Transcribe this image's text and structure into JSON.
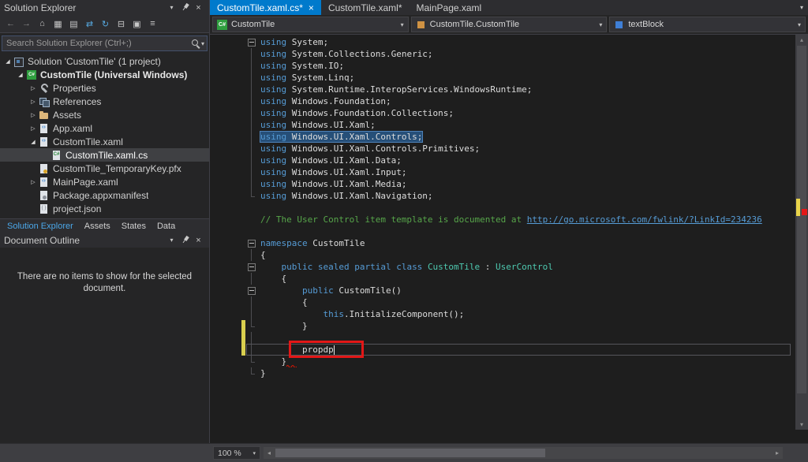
{
  "colors": {
    "accent": "#007acc",
    "editor_background": "#1e1e1e",
    "panel_background": "#252526",
    "keyword": "#569cd6",
    "type_name": "#4ec9b0",
    "comment": "#57a64a",
    "annotation_red": "#e31717",
    "change_bar_yellow": "#d9cf4e",
    "selection": "#264f78"
  },
  "solution_explorer": {
    "title": "Solution Explorer",
    "search_placeholder": "Search Solution Explorer (Ctrl+;)",
    "toolbar_icons": [
      {
        "name": "back",
        "glyph": "←",
        "color": "#8a8a8a"
      },
      {
        "name": "forward",
        "glyph": "→",
        "color": "#8a8a8a"
      },
      {
        "name": "home",
        "glyph": "⌂",
        "color": "#c8c8c8"
      },
      {
        "name": "switch-views",
        "glyph": "▦",
        "color": "#c8c8c8"
      },
      {
        "name": "pending-changes-filter",
        "glyph": "▤",
        "color": "#c8c8c8"
      },
      {
        "name": "sync-with-active-document",
        "glyph": "⇄",
        "color": "#56a9e0"
      },
      {
        "name": "refresh",
        "glyph": "↻",
        "color": "#56a9e0"
      },
      {
        "name": "collapse-all",
        "glyph": "⊟",
        "color": "#c8c8c8"
      },
      {
        "name": "show-all-files",
        "glyph": "▣",
        "color": "#c8c8c8"
      },
      {
        "name": "properties",
        "glyph": "≡",
        "color": "#c8c8c8"
      }
    ],
    "tree": [
      {
        "label": "Solution 'CustomTile' (1 project)",
        "level": 0,
        "icon": "solution",
        "expand": "expanded"
      },
      {
        "label": "CustomTile (Universal Windows)",
        "level": 1,
        "icon": "csharp-project",
        "expand": "expanded",
        "bold": true
      },
      {
        "label": "Properties",
        "level": 2,
        "icon": "properties",
        "expand": "collapsed"
      },
      {
        "label": "References",
        "level": 2,
        "icon": "references",
        "expand": "collapsed"
      },
      {
        "label": "Assets",
        "level": 2,
        "icon": "folder",
        "expand": "collapsed"
      },
      {
        "label": "App.xaml",
        "level": 2,
        "icon": "xaml-file",
        "expand": "collapsed"
      },
      {
        "label": "CustomTile.xaml",
        "level": 2,
        "icon": "xaml-file",
        "expand": "expanded"
      },
      {
        "label": "CustomTile.xaml.cs",
        "level": 3,
        "icon": "cs-file",
        "selected": true
      },
      {
        "label": "CustomTile_TemporaryKey.pfx",
        "level": 2,
        "icon": "certificate"
      },
      {
        "label": "MainPage.xaml",
        "level": 2,
        "icon": "xaml-file",
        "expand": "collapsed"
      },
      {
        "label": "Package.appxmanifest",
        "level": 2,
        "icon": "manifest"
      },
      {
        "label": "project.json",
        "level": 2,
        "icon": "json-file"
      }
    ],
    "bottom_tabs": [
      {
        "label": "Solution Explorer",
        "active": true
      },
      {
        "label": "Assets"
      },
      {
        "label": "States"
      },
      {
        "label": "Data"
      }
    ]
  },
  "document_outline": {
    "title": "Document Outline",
    "empty_message": "There are no items to show for the selected document."
  },
  "editor": {
    "tabs": [
      {
        "label": "CustomTile.xaml.cs*",
        "active": true
      },
      {
        "label": "CustomTile.xaml*"
      },
      {
        "label": "MainPage.xaml"
      }
    ],
    "navbar": {
      "project": "CustomTile",
      "type": "CustomTile.CustomTile",
      "member": "textBlock"
    },
    "zoom": "100 %",
    "code": [
      {
        "fold": "box",
        "t": [
          [
            "kw",
            "using"
          ],
          [
            "pl",
            " System;"
          ]
        ]
      },
      {
        "fold": "line",
        "t": [
          [
            "kw",
            "using"
          ],
          [
            "pl",
            " System.Collections.Generic;"
          ]
        ]
      },
      {
        "fold": "line",
        "t": [
          [
            "kw",
            "using"
          ],
          [
            "pl",
            " System.IO;"
          ]
        ]
      },
      {
        "fold": "line",
        "t": [
          [
            "kw",
            "using"
          ],
          [
            "pl",
            " System.Linq;"
          ]
        ]
      },
      {
        "fold": "line",
        "t": [
          [
            "kw",
            "using"
          ],
          [
            "pl",
            " System.Runtime.InteropServices.WindowsRuntime;"
          ]
        ]
      },
      {
        "fold": "line",
        "t": [
          [
            "kw",
            "using"
          ],
          [
            "pl",
            " Windows.Foundation;"
          ]
        ]
      },
      {
        "fold": "line",
        "t": [
          [
            "kw",
            "using"
          ],
          [
            "pl",
            " Windows.Foundation.Collections;"
          ]
        ]
      },
      {
        "fold": "line",
        "t": [
          [
            "kw",
            "using"
          ],
          [
            "pl",
            " Windows.UI.Xaml;"
          ]
        ]
      },
      {
        "fold": "line",
        "hl": true,
        "t": [
          [
            "kw",
            "using"
          ],
          [
            "pl",
            " Windows.UI.Xaml.Controls;"
          ]
        ]
      },
      {
        "fold": "line",
        "t": [
          [
            "kw",
            "using"
          ],
          [
            "pl",
            " Windows.UI.Xaml.Controls.Primitives;"
          ]
        ]
      },
      {
        "fold": "line",
        "t": [
          [
            "kw",
            "using"
          ],
          [
            "pl",
            " Windows.UI.Xaml.Data;"
          ]
        ]
      },
      {
        "fold": "line",
        "t": [
          [
            "kw",
            "using"
          ],
          [
            "pl",
            " Windows.UI.Xaml.Input;"
          ]
        ]
      },
      {
        "fold": "line",
        "t": [
          [
            "kw",
            "using"
          ],
          [
            "pl",
            " Windows.UI.Xaml.Media;"
          ]
        ]
      },
      {
        "fold": "end",
        "t": [
          [
            "kw",
            "using"
          ],
          [
            "pl",
            " Windows.UI.Xaml.Navigation;"
          ]
        ]
      },
      {
        "t": []
      },
      {
        "t": [
          [
            "cm",
            "// The User Control item template is documented at "
          ],
          [
            "lk",
            "http://go.microsoft.com/fwlink/?LinkId=234236"
          ]
        ]
      },
      {
        "t": []
      },
      {
        "fold": "box",
        "t": [
          [
            "kw",
            "namespace"
          ],
          [
            "pl",
            " CustomTile"
          ]
        ]
      },
      {
        "fold": "line",
        "t": [
          [
            "pl",
            "{"
          ]
        ]
      },
      {
        "fold": "box",
        "t": [
          [
            "pl",
            "    "
          ],
          [
            "kw",
            "public sealed partial class"
          ],
          [
            "pl",
            " "
          ],
          [
            "ty",
            "CustomTile"
          ],
          [
            "pl",
            " : "
          ],
          [
            "ty",
            "UserControl"
          ]
        ]
      },
      {
        "fold": "line",
        "t": [
          [
            "pl",
            "    {"
          ]
        ]
      },
      {
        "fold": "box",
        "t": [
          [
            "pl",
            "        "
          ],
          [
            "kw",
            "public"
          ],
          [
            "pl",
            " CustomTile()"
          ]
        ]
      },
      {
        "fold": "line",
        "t": [
          [
            "pl",
            "        {"
          ]
        ]
      },
      {
        "fold": "line",
        "t": [
          [
            "pl",
            "            "
          ],
          [
            "kw",
            "this"
          ],
          [
            "pl",
            ".InitializeComponent();"
          ]
        ]
      },
      {
        "fold": "end",
        "t": [
          [
            "pl",
            "        }"
          ]
        ]
      },
      {
        "fold": "line",
        "t": []
      },
      {
        "fold": "line",
        "cur": true,
        "t": [
          [
            "pl",
            "        propdp"
          ]
        ]
      },
      {
        "fold": "end",
        "t": [
          [
            "pl",
            "    }"
          ]
        ]
      },
      {
        "fold": "end",
        "t": [
          [
            "pl",
            "}"
          ]
        ]
      }
    ]
  }
}
